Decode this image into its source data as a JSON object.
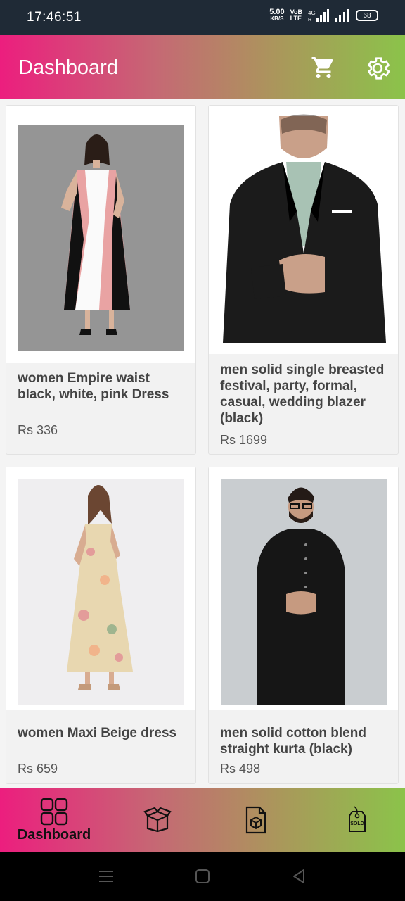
{
  "status": {
    "time": "17:46:51",
    "speed_value": "5.00",
    "speed_unit": "KB/S",
    "volte_top": "VoB",
    "volte_bottom": "LTE",
    "network": "4G",
    "battery": "68"
  },
  "app_bar": {
    "title": "Dashboard",
    "cart_icon": "cart-icon",
    "settings_icon": "gear-icon"
  },
  "products": [
    {
      "name": "women Empire waist black, white, pink Dress",
      "price": "Rs 336",
      "image": "woman-pink-dress"
    },
    {
      "name": "men solid single breasted festival, party, formal, casual, wedding blazer (black)",
      "price": "Rs 1699",
      "image": "man-black-blazer"
    },
    {
      "name": "women Maxi Beige dress",
      "price": "Rs 659",
      "image": "woman-floral-maxi"
    },
    {
      "name": "men solid cotton blend straight kurta (black)",
      "price": "Rs 498",
      "image": "man-black-kurta"
    }
  ],
  "bottom_nav": {
    "items": [
      {
        "label": "Dashboard",
        "icon": "grid-icon",
        "active": true
      },
      {
        "label": "",
        "icon": "box-icon"
      },
      {
        "label": "",
        "icon": "document-icon"
      },
      {
        "label": "",
        "icon": "sold-tag-icon"
      }
    ]
  },
  "colors": {
    "gradient_start": "#ec1e7e",
    "gradient_end": "#8bc34a",
    "status_bar": "#1f2a36"
  }
}
